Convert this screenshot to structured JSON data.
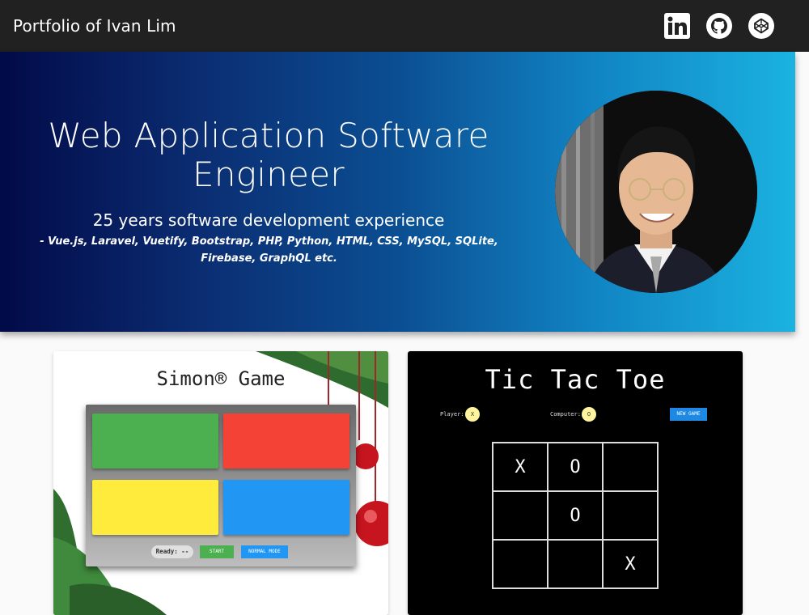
{
  "header": {
    "title": "Portfolio of Ivan Lim",
    "icons": [
      "linkedin-icon",
      "github-icon",
      "codepen-icon"
    ]
  },
  "hero": {
    "headline": "Web Application Software Engineer",
    "subheadline": "25 years software development experience",
    "tech": "- Vue.js, Laravel, Vuetify, Bootstrap, PHP, Python, HTML, CSS, MySQL, SQLite, Firebase, GraphQL etc."
  },
  "projects": {
    "simon": {
      "title": "Simon® Game",
      "ready_label": "Ready: --",
      "start_label": "START",
      "mode_label": "NORMAL MODE"
    },
    "tictactoe": {
      "title": "Tic Tac Toe",
      "player_label": "Player:",
      "player_mark": "X",
      "computer_label": "Computer:",
      "computer_mark": "O",
      "new_game_label": "NEW GAME",
      "board": [
        "X",
        "O",
        "",
        "",
        "O",
        "",
        "",
        "",
        "X"
      ]
    }
  },
  "colors": {
    "topbar": "#212121",
    "hero_left": "#020a48",
    "hero_right": "#1bb2e0",
    "simon_green": "#4caf50",
    "simon_red": "#f44336",
    "simon_yellow": "#ffeb3b",
    "simon_blue": "#2196f3"
  }
}
